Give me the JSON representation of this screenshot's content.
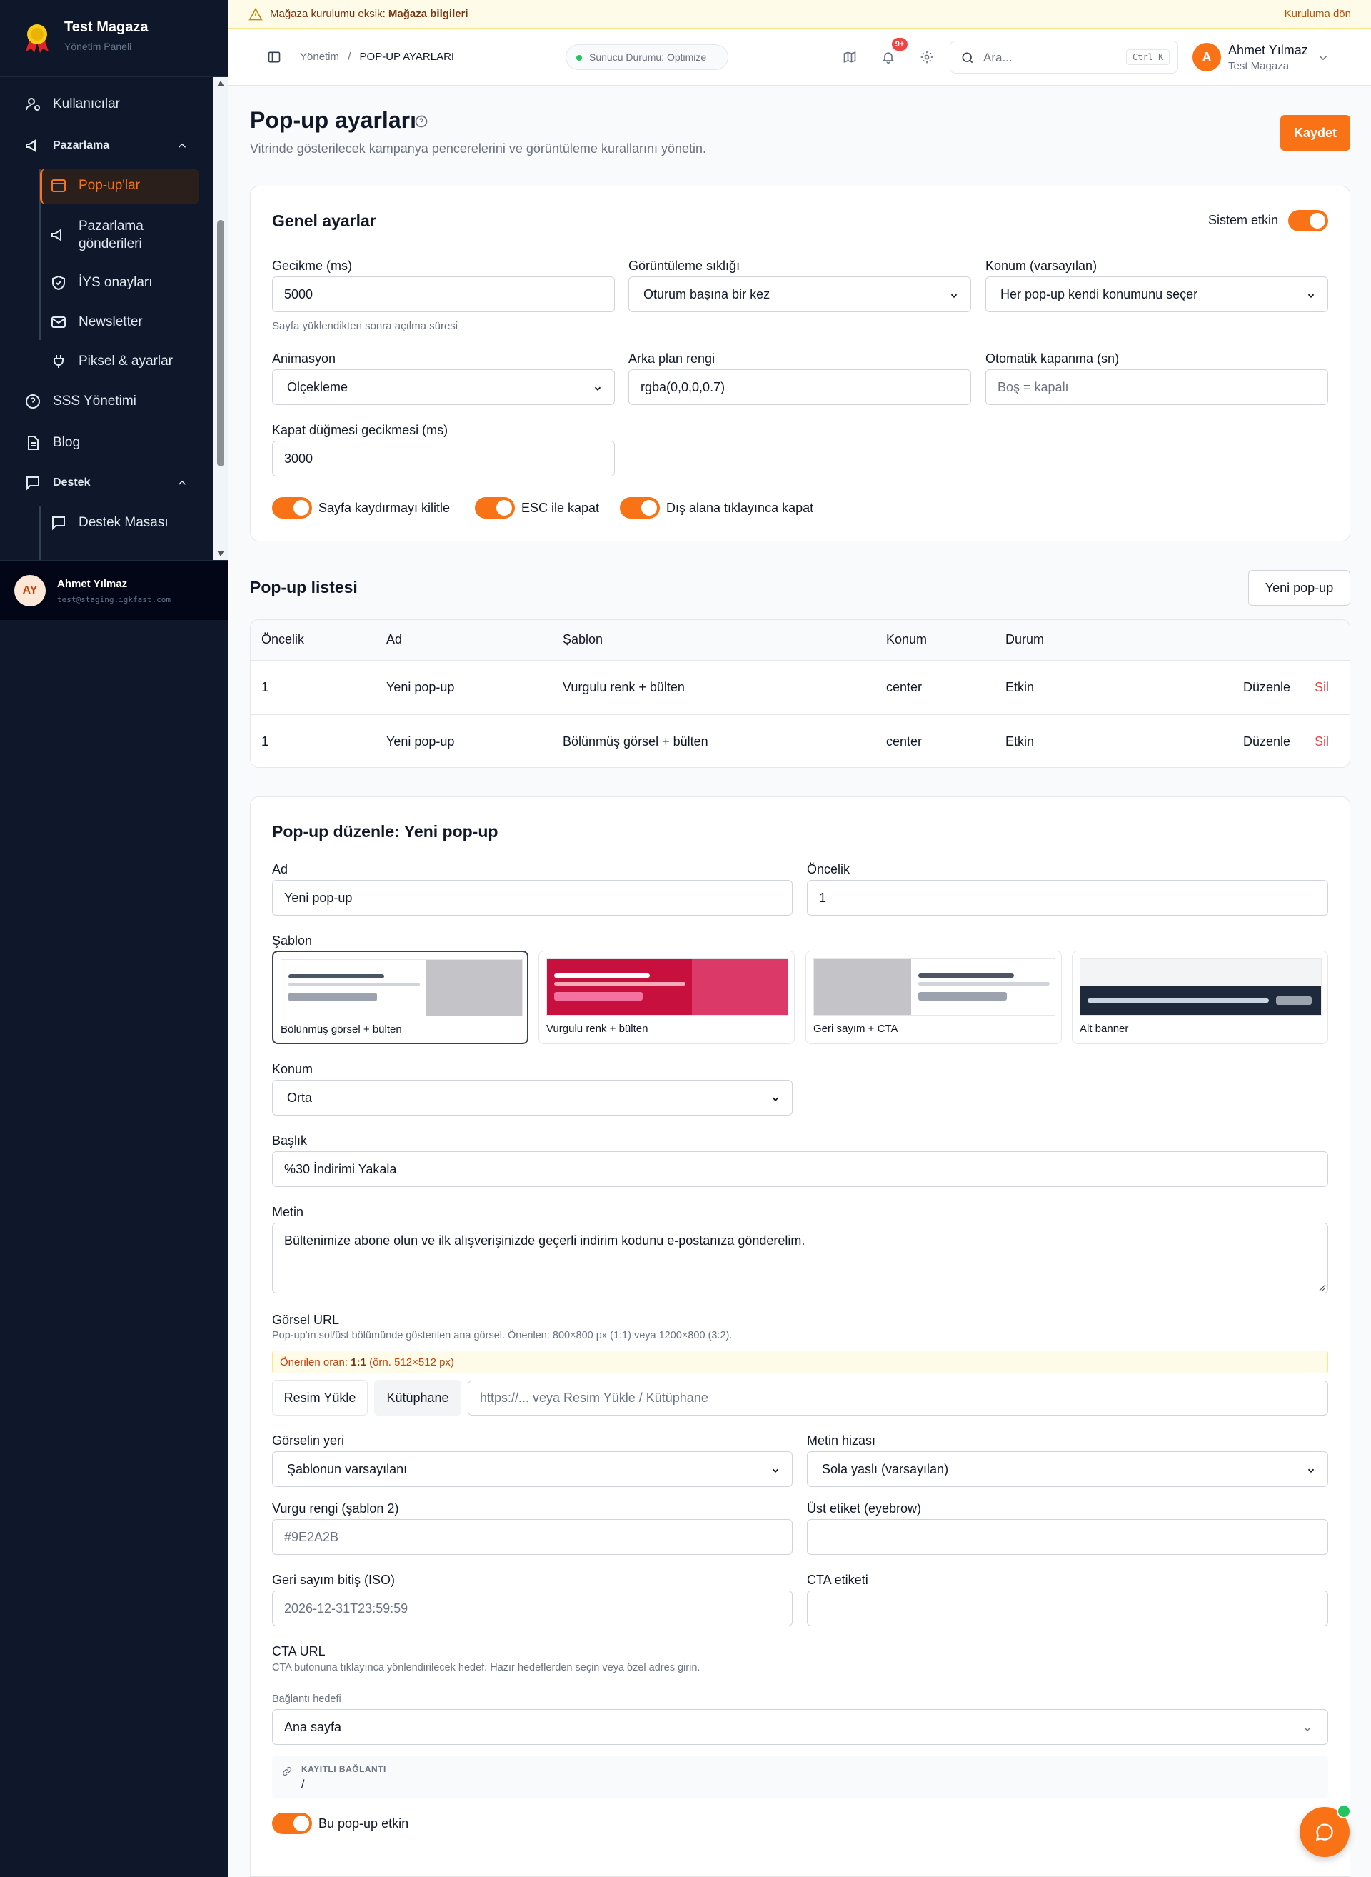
{
  "brand": {
    "name": "Test Magaza",
    "subtitle": "Yönetim Paneli"
  },
  "sidebar": {
    "items": [
      {
        "label": "Kullanıcılar",
        "icon": "user-cog-icon"
      },
      {
        "label": "Pazarlama",
        "icon": "megaphone-icon"
      },
      {
        "label": "Pop-up'lar",
        "icon": "window-icon"
      },
      {
        "label": "Pazarlama gönderileri",
        "icon": "megaphone-icon"
      },
      {
        "label": "İYS onayları",
        "icon": "shield-icon"
      },
      {
        "label": "Newsletter",
        "icon": "mail-icon"
      },
      {
        "label": "Piksel & ayarlar",
        "icon": "plug-icon"
      },
      {
        "label": "SSS Yönetimi",
        "icon": "help-circle-icon"
      },
      {
        "label": "Blog",
        "icon": "file-text-icon"
      },
      {
        "label": "Destek",
        "icon": "message-icon"
      },
      {
        "label": "Destek Masası",
        "icon": "message-icon"
      }
    ],
    "active": "Pop-up'lar"
  },
  "user": {
    "initials": "AY",
    "name": "Ahmet Yılmaz",
    "email": "test@staging.igkfast.com",
    "avatar_letter": "A",
    "store": "Test Magaza"
  },
  "banner": {
    "prefix": "Mağaza kurulumu eksik:",
    "bold": "Mağaza bilgileri",
    "action": "Kuruluma dön"
  },
  "topbar": {
    "breadcrumb_root": "Yönetim",
    "breadcrumb_sep": "/",
    "breadcrumb_current": "POP-UP AYARLARI",
    "server_status": "Sunucu Durumu: Optimize",
    "notif_badge": "9+",
    "search_placeholder": "Ara...",
    "search_shortcut": "Ctrl K"
  },
  "page": {
    "title": "Pop-up ayarları",
    "subtitle": "Vitrinde gösterilecek kampanya pencerelerini ve görüntüleme kurallarını yönetin.",
    "save": "Kaydet"
  },
  "general": {
    "title": "Genel ayarlar",
    "system_label": "Sistem etkin",
    "delay_label": "Gecikme (ms)",
    "delay_value": "5000",
    "delay_hint": "Sayfa yüklendikten sonra açılma süresi",
    "freq_label": "Görüntüleme sıklığı",
    "freq_value": "Oturum başına bir kez",
    "pos_label": "Konum (varsayılan)",
    "pos_value": "Her pop-up kendi konumunu seçer",
    "anim_label": "Animasyon",
    "anim_value": "Ölçekleme",
    "bg_label": "Arka plan rengi",
    "bg_value": "rgba(0,0,0,0.7)",
    "auto_label": "Otomatik kapanma (sn)",
    "auto_placeholder": "Boş = kapalı",
    "close_delay_label": "Kapat düğmesi gecikmesi (ms)",
    "close_delay_value": "3000",
    "toggles": [
      "Sayfa kaydırmayı kilitle",
      "ESC ile kapat",
      "Dış alana tıklayınca kapat"
    ]
  },
  "list": {
    "title": "Pop-up listesi",
    "new_button": "Yeni pop-up",
    "columns": [
      "Öncelik",
      "Ad",
      "Şablon",
      "Konum",
      "Durum"
    ],
    "rows": [
      {
        "priority": "1",
        "name": "Yeni pop-up",
        "template": "Vurgulu renk + bülten",
        "position": "center",
        "status": "Etkin"
      },
      {
        "priority": "1",
        "name": "Yeni pop-up",
        "template": "Bölünmüş görsel + bülten",
        "position": "center",
        "status": "Etkin"
      }
    ],
    "edit": "Düzenle",
    "delete": "Sil"
  },
  "editor": {
    "title": "Pop-up düzenle: Yeni pop-up",
    "name_label": "Ad",
    "name_value": "Yeni pop-up",
    "priority_label": "Öncelik",
    "priority_value": "1",
    "template_label": "Şablon",
    "templates": [
      "Bölünmüş görsel + bülten",
      "Vurgulu renk + bülten",
      "Geri sayım + CTA",
      "Alt banner"
    ],
    "position_label": "Konum",
    "position_value": "Orta",
    "heading_label": "Başlık",
    "heading_value": "%30 İndirimi Yakala",
    "text_label": "Metin",
    "text_value": "Bültenimize abone olun ve ilk alışverişinizde geçerli indirim kodunu e-postanıza gönderelim.",
    "image_label": "Görsel URL",
    "image_hint": "Pop-up'ın sol/üst bölümünde gösterilen ana görsel. Önerilen: 800×800 px (1:1) veya 1200×800 (3:2).",
    "ratio_prefix": "Önerilen oran:",
    "ratio_value": "1:1",
    "ratio_suffix": "(örn. 512×512 px)",
    "upload": "Resim Yükle",
    "library": "Kütüphane",
    "image_placeholder": "https://... veya Resim Yükle / Kütüphane",
    "imgpos_label": "Görselin yeri",
    "imgpos_value": "Şablonun varsayılanı",
    "align_label": "Metin hizası",
    "align_value": "Sola yaslı (varsayılan)",
    "accent_label": "Vurgu rengi (şablon 2)",
    "accent_placeholder": "#9E2A2B",
    "eyebrow_label": "Üst etiket (eyebrow)",
    "countdown_label": "Geri sayım bitiş (ISO)",
    "countdown_placeholder": "2026-12-31T23:59:59",
    "cta_label": "CTA etiketi",
    "cta_url_label": "CTA URL",
    "cta_url_hint": "CTA butonuna tıklayınca yönlendirilecek hedef. Hazır hedeflerden seçin veya özel adres girin.",
    "target_label": "Bağlantı hedefi",
    "target_value": "Ana sayfa",
    "saved_label": "KAYITLI BAĞLANTI",
    "saved_value": "/",
    "enabled_label": "Bu pop-up etkin"
  },
  "colors": {
    "accent": "#f97316",
    "sidebar": "#0f172a",
    "danger": "#ef4444",
    "template_red": "#c8103e"
  }
}
